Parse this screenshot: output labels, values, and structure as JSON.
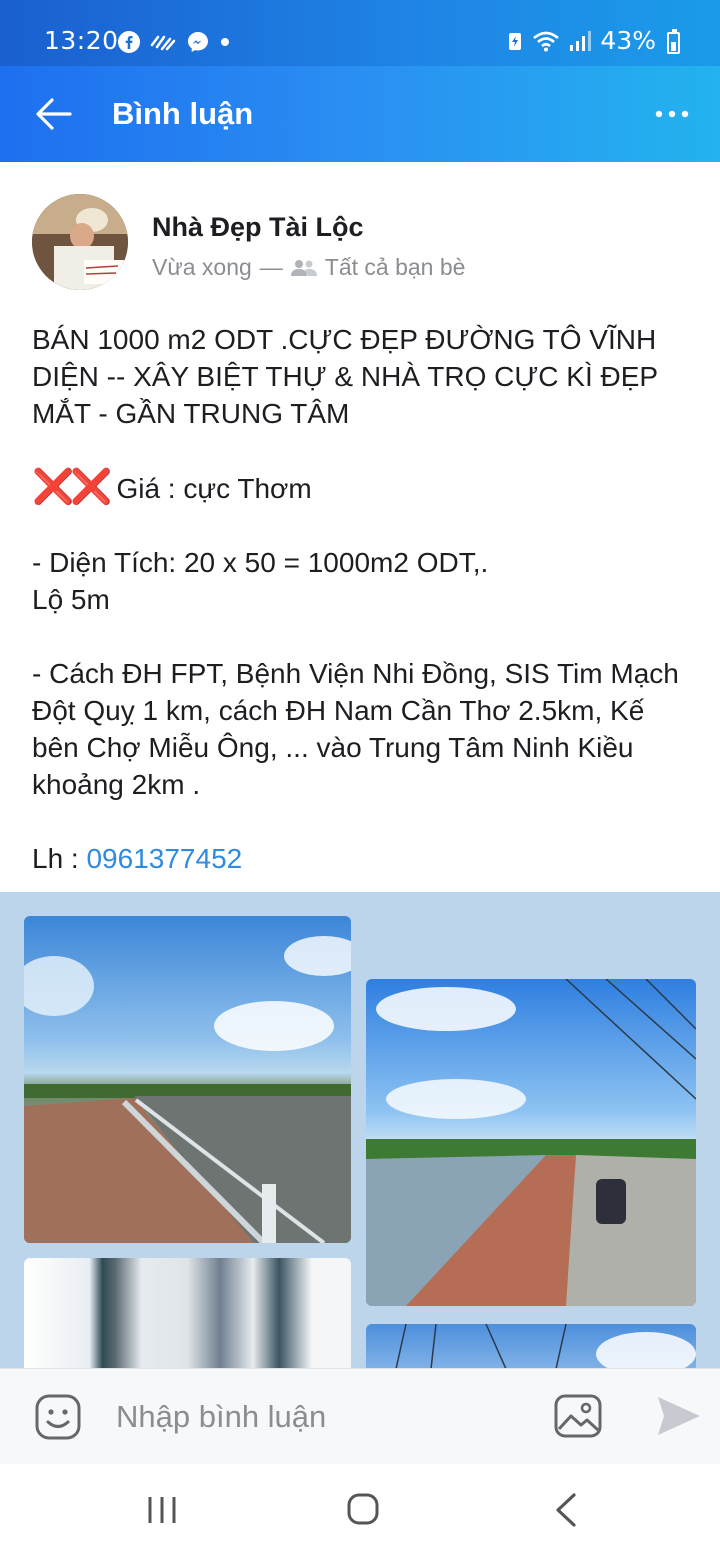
{
  "status_bar": {
    "time": "13:20",
    "battery": "43%",
    "icons": [
      "facebook-icon",
      "activity-icon",
      "messenger-icon",
      "dot-icon",
      "battery-saver-icon",
      "wifi-icon",
      "signal-icon",
      "battery-icon"
    ]
  },
  "app_bar": {
    "title": "Bình luận",
    "back_icon": "arrow-left-icon",
    "more_icon": "more-horizontal-icon"
  },
  "post": {
    "author": "Nhà Đẹp Tài Lộc",
    "time": "Vừa xong",
    "separator": "—",
    "audience": "Tất cả bạn bè",
    "audience_icon": "friends-icon",
    "lines": {
      "headline": "BÁN 1000 m2 ODT .CỰC ĐẸP ĐƯỜNG TÔ VĨNH DIỆN -- XÂY BIỆT THỰ & NHÀ TRỌ CỰC KÌ ĐẸP MẮT - GẦN TRUNG TÂM",
      "price_emoji": "❌❌",
      "price": " Giá : cực Thơm",
      "area": "- Diện Tích: 20 x 50 = 1000m2 ODT,.",
      "road": "Lộ 5m",
      "location": "- Cách ĐH FPT, Bệnh Viện Nhi Đồng, SIS Tim Mạch Đột Quỵ 1 km, cách ĐH Nam Cần Thơ 2.5km, Kế bên Chợ Miễu Ông, ... vào Trung Tâm Ninh Kiều khoảng 2km .",
      "contact_label": "Lh : ",
      "phone": "0961377452"
    },
    "photos": [
      "photo-canal-walkway",
      "photo-riverside-road",
      "photo-interior",
      "photo-sky-wires"
    ]
  },
  "comment_bar": {
    "placeholder": "Nhập bình luận",
    "emoji_icon": "emoji-icon",
    "image_icon": "image-icon",
    "send_icon": "send-icon"
  },
  "nav_bar": {
    "icons": [
      "recent-apps-icon",
      "home-icon",
      "back-icon"
    ]
  },
  "colors": {
    "app_bar_start": "#1e6ff0",
    "app_bar_end": "#23b3ef",
    "link": "#2f8be0",
    "photo_bg": "#bcd5ea"
  }
}
